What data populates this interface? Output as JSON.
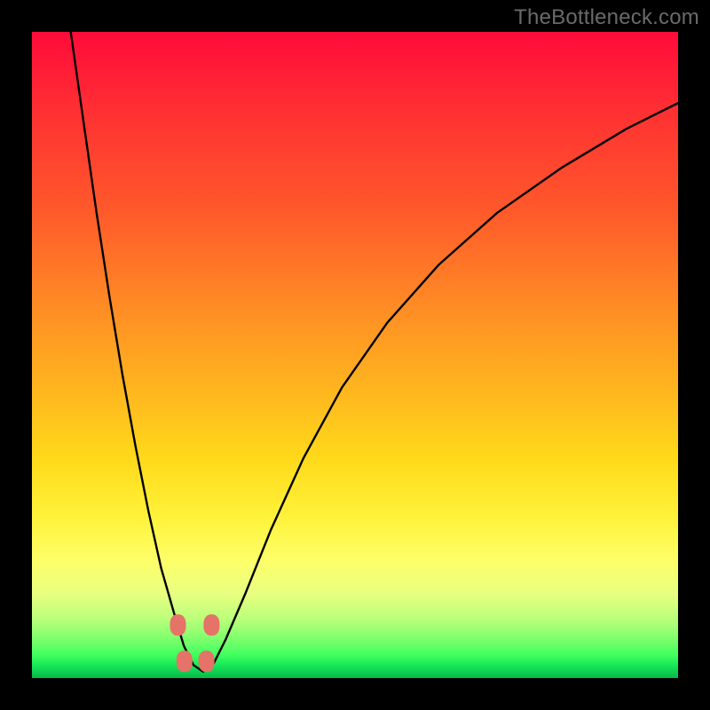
{
  "watermark": "TheBottleneck.com",
  "colors": {
    "frame": "#000000",
    "gradient_top": "#ff0b3a",
    "gradient_bottom": "#08b848",
    "curve": "#000000",
    "dots": "#e57368"
  },
  "chart_data": {
    "type": "line",
    "title": "",
    "xlabel": "",
    "ylabel": "",
    "xlim": [
      0,
      100
    ],
    "ylim": [
      0,
      100
    ],
    "annotations": [],
    "series": [
      {
        "name": "bottleneck-curve",
        "x": [
          6,
          8,
          10,
          12,
          14,
          16,
          18,
          20,
          22,
          23.5,
          25,
          26.5,
          28,
          30,
          33,
          37,
          42,
          48,
          55,
          63,
          72,
          82,
          92,
          100
        ],
        "y": [
          100,
          86,
          72,
          59,
          47,
          36,
          26,
          17,
          10,
          5,
          2,
          1,
          2,
          6,
          13,
          23,
          34,
          45,
          55,
          64,
          72,
          79,
          85,
          89
        ]
      }
    ],
    "markers": [
      {
        "x": 22.6,
        "y": 8.2
      },
      {
        "x": 27.8,
        "y": 8.2
      },
      {
        "x": 23.6,
        "y": 2.6
      },
      {
        "x": 27.0,
        "y": 2.6
      }
    ],
    "legend": []
  }
}
